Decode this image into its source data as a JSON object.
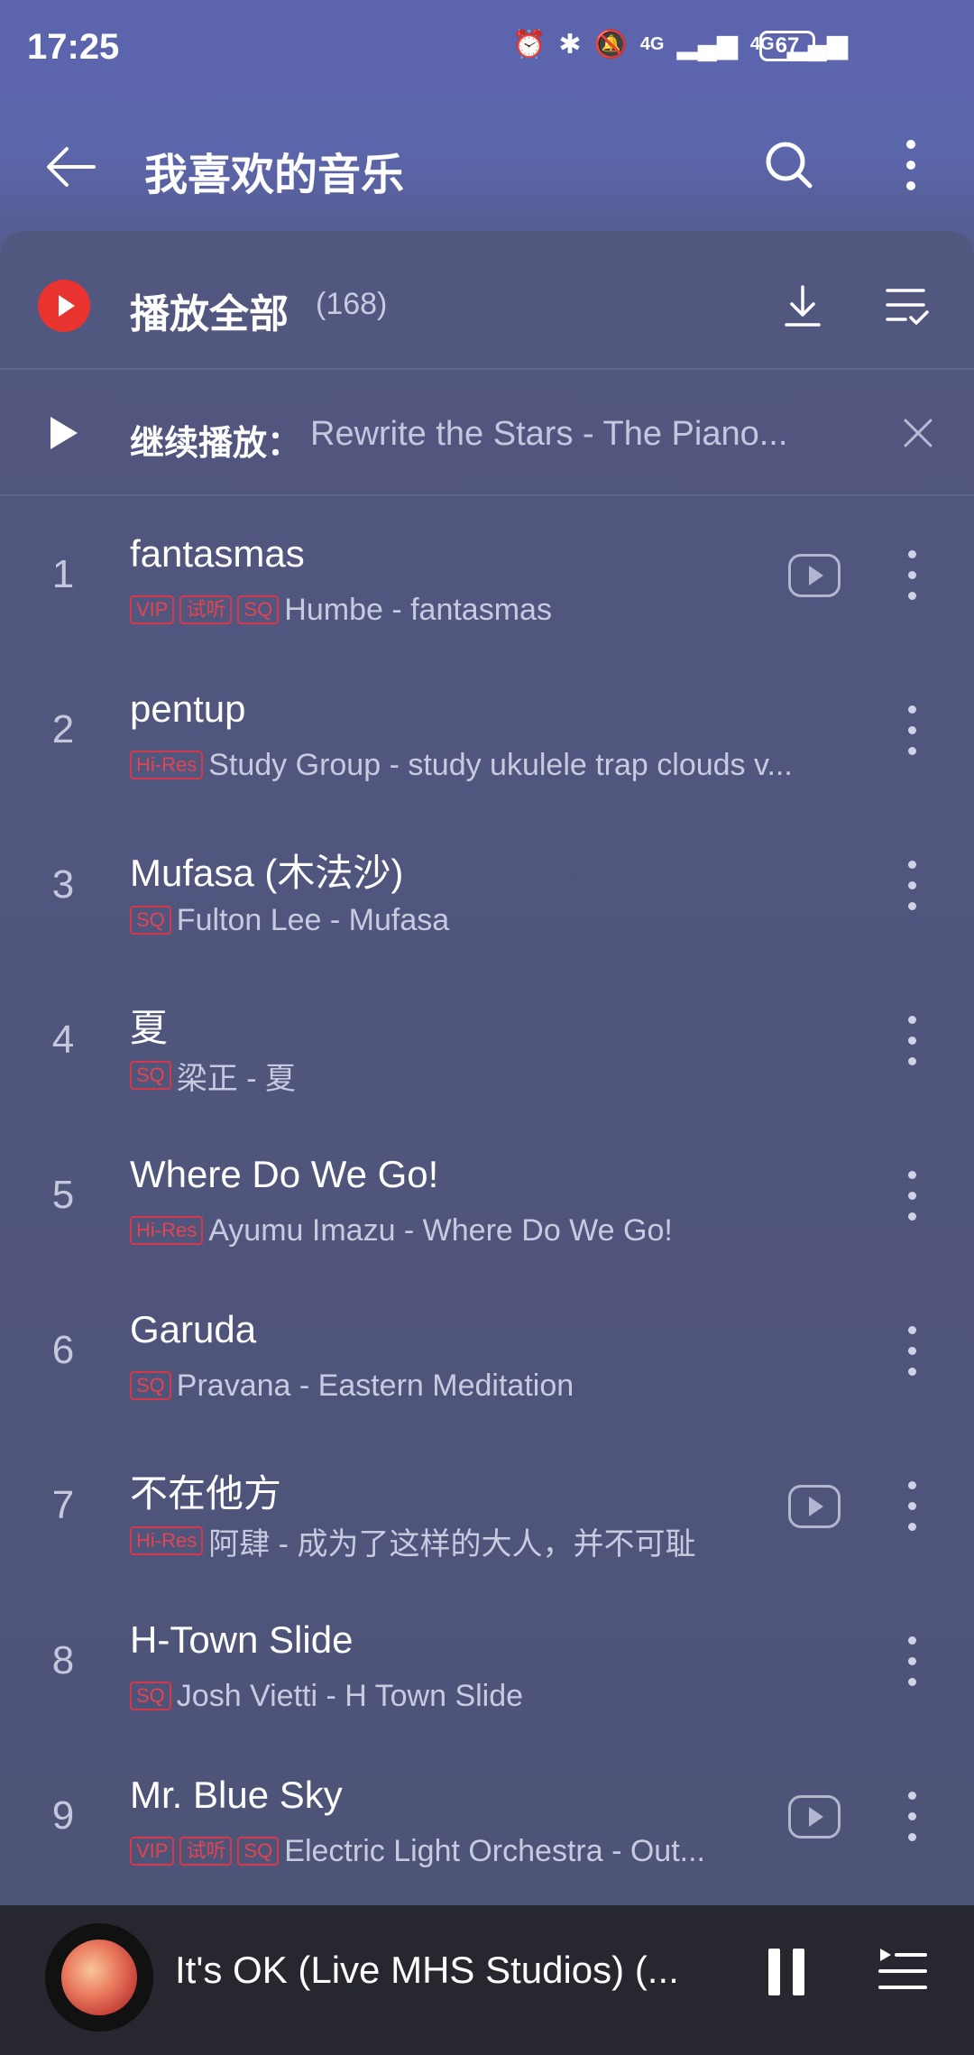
{
  "status": {
    "time": "17:25",
    "signal1": "4G",
    "signal2": "4G",
    "battery": "67"
  },
  "header": {
    "title": "我喜欢的音乐",
    "back_icon": "arrow-left-icon",
    "search_icon": "search-icon",
    "more_icon": "more-vertical-icon"
  },
  "play_all": {
    "label": "播放全部",
    "count": "(168)",
    "accent": "#e8332e"
  },
  "resume": {
    "label": "继续播放：",
    "song": "Rewrite the Stars - The Piano..."
  },
  "songs": [
    {
      "index": "1",
      "title": "fantasmas",
      "badges": [
        "VIP",
        "试听",
        "SQ"
      ],
      "artist": "Humbe - fantasmas",
      "has_mv": true
    },
    {
      "index": "2",
      "title": "pentup",
      "badges": [
        "Hi-Res"
      ],
      "artist": "Study Group - study ukulele trap clouds v...",
      "has_mv": false
    },
    {
      "index": "3",
      "title": "Mufasa (木法沙)",
      "badges": [
        "SQ"
      ],
      "artist": "Fulton Lee - Mufasa",
      "has_mv": false
    },
    {
      "index": "4",
      "title": "夏",
      "badges": [
        "SQ"
      ],
      "artist": "梁正 - 夏",
      "has_mv": false
    },
    {
      "index": "5",
      "title": "Where Do We Go!",
      "badges": [
        "Hi-Res"
      ],
      "artist": "Ayumu Imazu - Where Do We Go!",
      "has_mv": false
    },
    {
      "index": "6",
      "title": "Garuda",
      "badges": [
        "SQ"
      ],
      "artist": "Pravana - Eastern Meditation",
      "has_mv": false
    },
    {
      "index": "7",
      "title": "不在他方",
      "badges": [
        "Hi-Res"
      ],
      "artist": "阿肆 - 成为了这样的大人，并不可耻",
      "has_mv": true
    },
    {
      "index": "8",
      "title": "H-Town Slide",
      "badges": [
        "SQ"
      ],
      "artist": "Josh Vietti - H Town Slide",
      "has_mv": false
    },
    {
      "index": "9",
      "title": "Mr. Blue Sky",
      "badges": [
        "VIP",
        "试听",
        "SQ"
      ],
      "artist": "Electric Light Orchestra - Out...",
      "has_mv": true
    }
  ],
  "player": {
    "title": "It's OK (Live MHS Studios) (..."
  }
}
